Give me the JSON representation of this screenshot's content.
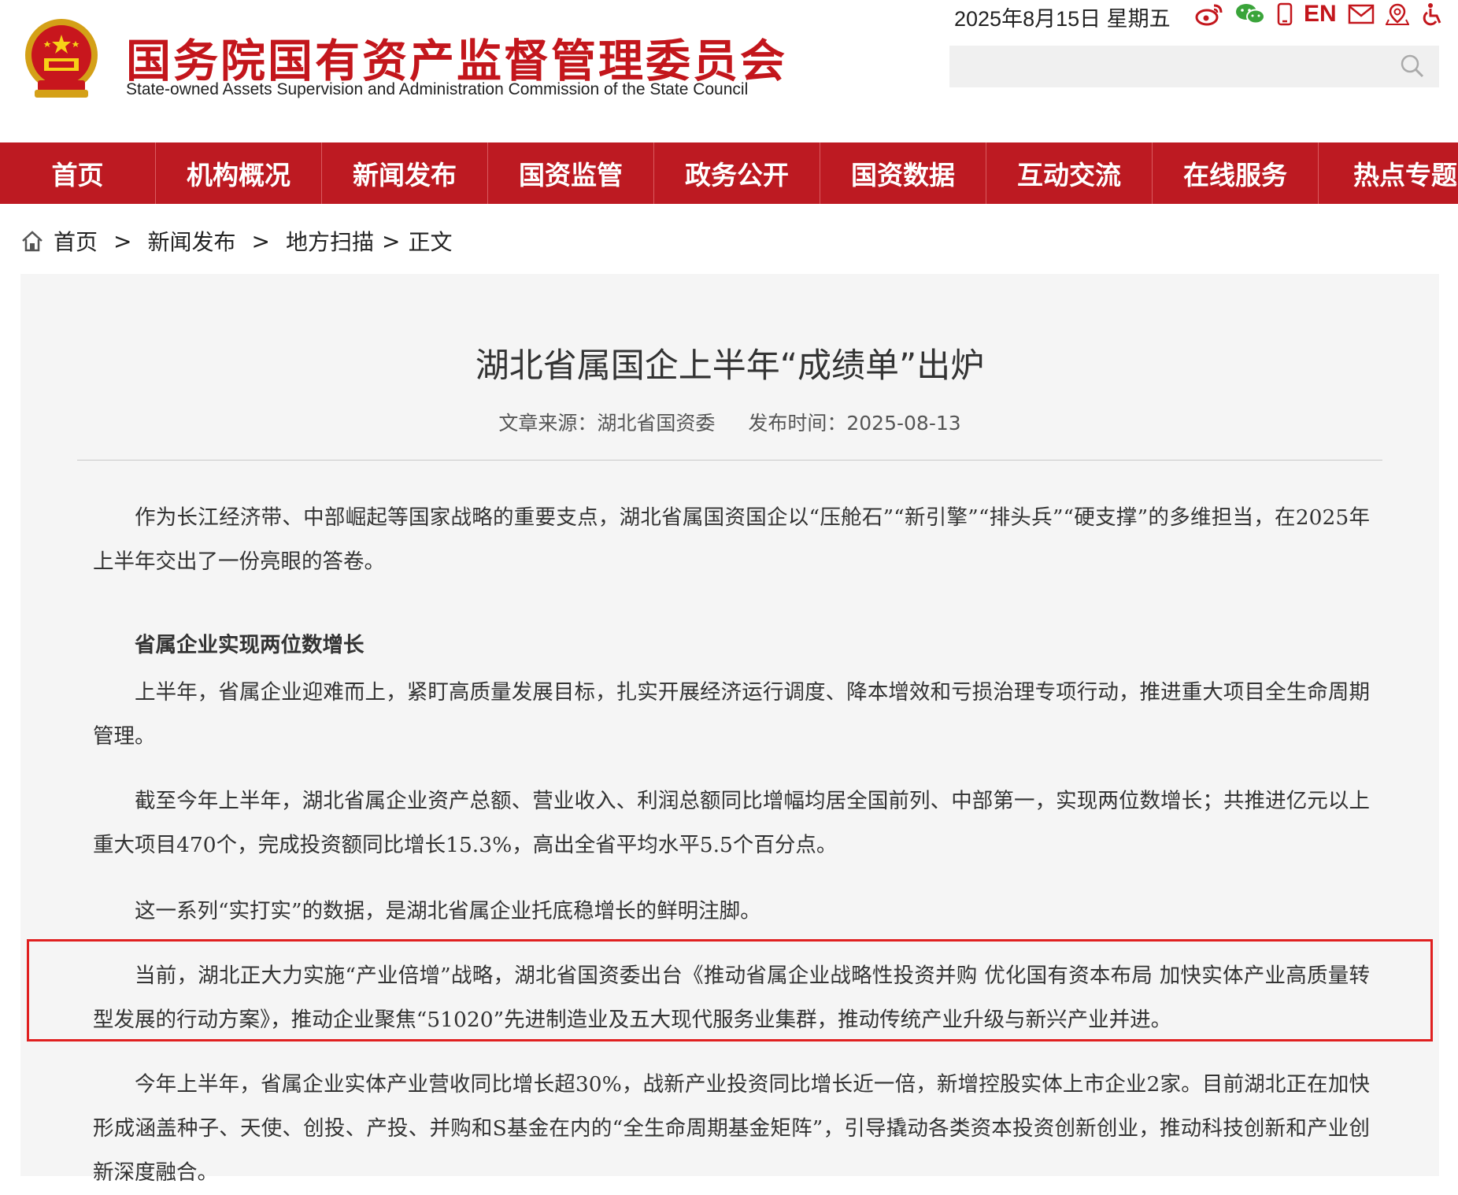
{
  "header": {
    "site_title": "国务院国有资产监督管理委员会",
    "site_subtitle": "State-owned Assets Supervision and Administration Commission of the State Council",
    "date": "2025年8月15日 星期五",
    "en_label": "EN",
    "icons": [
      "weibo-icon",
      "wechat-icon",
      "mobile-icon",
      "en-link",
      "mail-icon",
      "location-icon",
      "accessibility-icon"
    ],
    "search": {
      "value": "",
      "placeholder": ""
    }
  },
  "nav": {
    "items": [
      "首页",
      "机构概况",
      "新闻发布",
      "国资监管",
      "政务公开",
      "国资数据",
      "互动交流",
      "在线服务",
      "热点专题"
    ]
  },
  "breadcrumb": {
    "items": [
      "首页",
      "新闻发布",
      "地方扫描",
      "正文"
    ],
    "separator": ">"
  },
  "article": {
    "title": "湖北省属国企上半年“成绩单”出炉",
    "source": "文章来源：湖北省国资委",
    "publish_time": "发布时间：2025-08-13",
    "paragraphs": [
      "作为长江经济带、中部崛起等国家战略的重要支点，湖北省属国资国企以“压舱石”“新引擎”“排头兵”“硬支撑”的多维担当，在2025年上半年交出了一份亮眼的答卷。",
      "省属企业实现两位数增长",
      "上半年，省属企业迎难而上，紧盯高质量发展目标，扎实开展经济运行调度、降本增效和亏损治理专项行动，推进重大项目全生命周期管理。",
      "截至今年上半年，湖北省属企业资产总额、营业收入、利润总额同比增幅均居全国前列、中部第一，实现两位数增长；共推进亿元以上重大项目470个，完成投资额同比增长15.3%，高出全省平均水平5.5个百分点。",
      "这一系列“实打实”的数据，是湖北省属企业托底稳增长的鲜明注脚。",
      "当前，湖北正大力实施“产业倍增”战略，湖北省国资委出台《推动省属企业战略性投资并购 优化国有资本布局 加快实体产业高质量转型发展的行动方案》，推动企业聚焦“51020”先进制造业及五大现代服务业集群，推动传统产业升级与新兴产业并进。",
      "今年上半年，省属企业实体产业营收同比增长超30%，战新产业投资同比增长近一倍，新增控股实体上市企业2家。目前湖北正在加快形成涵盖种子、天使、创投、产投、并购和S基金在内的“全生命周期基金矩阵”，引导撬动各类资本投资创新创业，推动科技创新和产业创新深度融合。"
    ]
  },
  "colors": {
    "brand_red": "#bd1a22",
    "title_red": "#c3161c",
    "highlight_border": "#e02020",
    "article_bg": "#f5f5f5"
  }
}
